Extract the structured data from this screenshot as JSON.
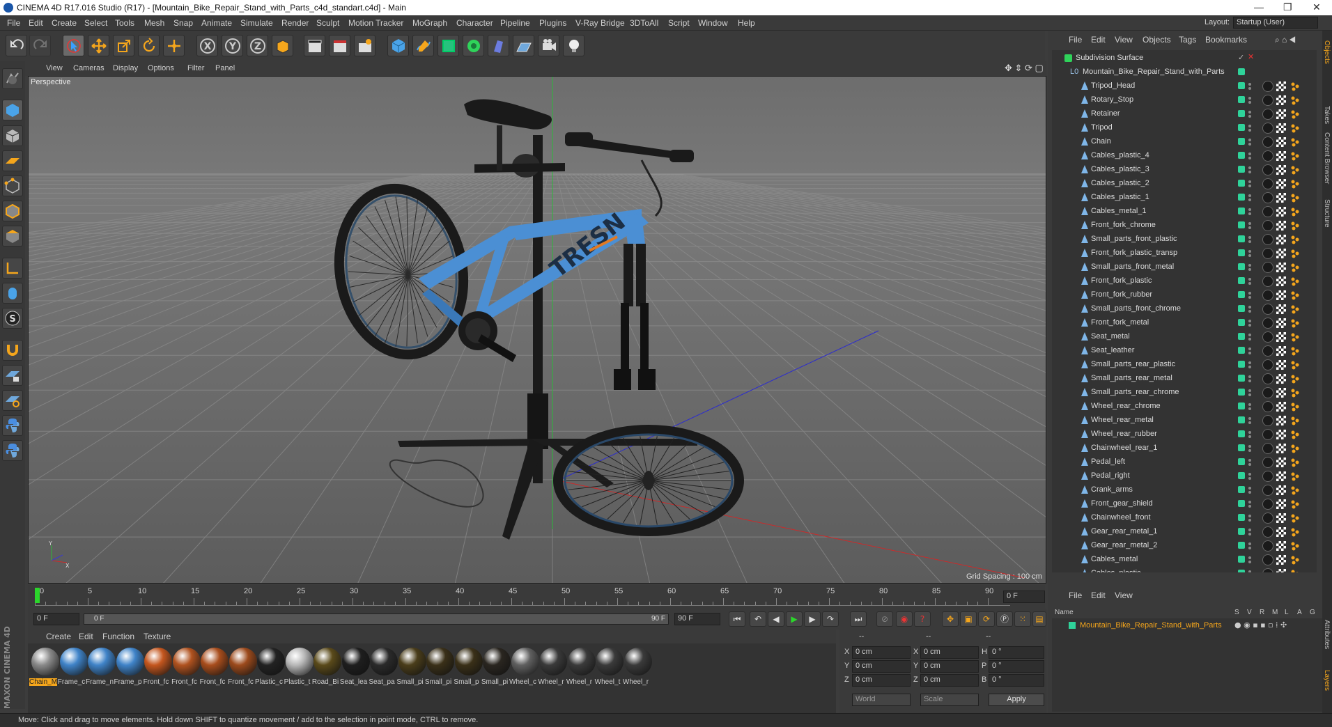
{
  "window": {
    "title": "CINEMA 4D R17.016 Studio (R17) - [Mountain_Bike_Repair_Stand_with_Parts_c4d_standart.c4d] - Main",
    "minimize": "—",
    "maximize": "❐",
    "close": "✕"
  },
  "menubar": [
    "File",
    "Edit",
    "Create",
    "Select",
    "Tools",
    "Mesh",
    "Snap",
    "Animate",
    "Simulate",
    "Render",
    "Sculpt",
    "Motion Tracker",
    "MoGraph",
    "Character",
    "Pipeline",
    "Plugins",
    "V-Ray Bridge",
    "3DToAll",
    "Script",
    "Window",
    "Help"
  ],
  "layout": {
    "label": "Layout:",
    "value": "Startup (User)"
  },
  "viewport": {
    "menu": [
      "View",
      "Cameras",
      "Display",
      "Options",
      "Filter",
      "Panel"
    ],
    "label": "Perspective",
    "grid_spacing": "Grid Spacing : 100 cm",
    "bike_brand": "TRESN"
  },
  "timeline": {
    "ticks": [
      "0",
      "5",
      "10",
      "15",
      "20",
      "25",
      "30",
      "35",
      "40",
      "45",
      "50",
      "55",
      "60",
      "65",
      "70",
      "75",
      "80",
      "85",
      "90"
    ],
    "current_frame": "0 F",
    "start": "0 F",
    "slider_start": "0 F",
    "slider_end": "90 F",
    "end": "90 F"
  },
  "materials": {
    "menu": [
      "Create",
      "Edit",
      "Function",
      "Texture"
    ],
    "items": [
      {
        "name": "Chain_M",
        "color": "#8a8a8a",
        "selected": true
      },
      {
        "name": "Frame_c",
        "color": "#3f83c8"
      },
      {
        "name": "Frame_n",
        "color": "#3f83c8"
      },
      {
        "name": "Frame_p",
        "color": "#3f83c8"
      },
      {
        "name": "Front_fc",
        "color": "#c4561e"
      },
      {
        "name": "Front_fc",
        "color": "#b0521f"
      },
      {
        "name": "Front_fc",
        "color": "#a84d1c"
      },
      {
        "name": "Front_fc",
        "color": "#9c4a1c"
      },
      {
        "name": "Plastic_c",
        "color": "#222222"
      },
      {
        "name": "Plastic_t",
        "color": "#b8b8b8"
      },
      {
        "name": "Road_Bi",
        "color": "#5a4a1a"
      },
      {
        "name": "Seat_lea",
        "color": "#1e1e1e"
      },
      {
        "name": "Seat_pa",
        "color": "#2a2a2a"
      },
      {
        "name": "Small_pi",
        "color": "#4a3d1a"
      },
      {
        "name": "Small_pi",
        "color": "#3a3018"
      },
      {
        "name": "Small_p",
        "color": "#3a3018"
      },
      {
        "name": "Small_pi",
        "color": "#2a2620"
      },
      {
        "name": "Wheel_c",
        "color": "#606060"
      },
      {
        "name": "Wheel_r",
        "color": "#3a3a3a"
      },
      {
        "name": "Wheel_r",
        "color": "#3a3a3a"
      },
      {
        "name": "Wheel_t",
        "color": "#3a3a3a"
      },
      {
        "name": "Wheel_r",
        "color": "#3a3a3a"
      }
    ]
  },
  "coords": {
    "headers": [
      "--",
      "--",
      "--"
    ],
    "rows": [
      {
        "a": "X",
        "av": "0 cm",
        "b": "X",
        "bv": "0 cm",
        "c": "H",
        "cv": "0 °"
      },
      {
        "a": "Y",
        "av": "0 cm",
        "b": "Y",
        "bv": "0 cm",
        "c": "P",
        "cv": "0 °"
      },
      {
        "a": "Z",
        "av": "0 cm",
        "b": "Z",
        "bv": "0 cm",
        "c": "B",
        "cv": "0 °"
      }
    ],
    "world": "World",
    "scale": "Scale",
    "apply": "Apply"
  },
  "object_manager": {
    "menu": [
      "File",
      "Edit",
      "View",
      "Objects",
      "Tags",
      "Bookmarks"
    ],
    "root": "Subdivision Surface",
    "group": "Mountain_Bike_Repair_Stand_with_Parts",
    "objects": [
      "Tripod_Head",
      "Rotary_Stop",
      "Retainer",
      "Tripod",
      "Chain",
      "Cables_plastic_4",
      "Cables_plastic_3",
      "Cables_plastic_2",
      "Cables_plastic_1",
      "Cables_metal_1",
      "Front_fork_chrome",
      "Small_parts_front_plastic",
      "Front_fork_plastic_transp",
      "Small_parts_front_metal",
      "Front_fork_plastic",
      "Front_fork_rubber",
      "Small_parts_front_chrome",
      "Front_fork_metal",
      "Seat_metal",
      "Seat_leather",
      "Small_parts_rear_plastic",
      "Small_parts_rear_metal",
      "Small_parts_rear_chrome",
      "Wheel_rear_chrome",
      "Wheel_rear_metal",
      "Wheel_rear_rubber",
      "Chainwheel_rear_1",
      "Pedal_left",
      "Pedal_right",
      "Crank_arms",
      "Front_gear_shield",
      "Chainwheel_front",
      "Gear_rear_metal_1",
      "Gear_rear_metal_2",
      "Cables_metal",
      "Cables_plastic"
    ]
  },
  "layer_manager": {
    "menu": [
      "File",
      "Edit",
      "View"
    ],
    "columns": [
      "Name",
      "S",
      "V",
      "R",
      "M",
      "L",
      "A",
      "G"
    ],
    "layer": "Mountain_Bike_Repair_Stand_with_Parts"
  },
  "side_tabs": [
    "Objects",
    "Takes",
    "Content Browser",
    "Structure",
    "Attributes",
    "Layers"
  ],
  "status": "Move: Click and drag to move elements. Hold down SHIFT to quantize movement / add to the selection in point mode, CTRL to remove.",
  "brand": "MAXON CINEMA 4D",
  "colors": {
    "accent": "#f5a61c",
    "layer_green": "#2fd39a",
    "timeline_green": "#2bd62b"
  }
}
